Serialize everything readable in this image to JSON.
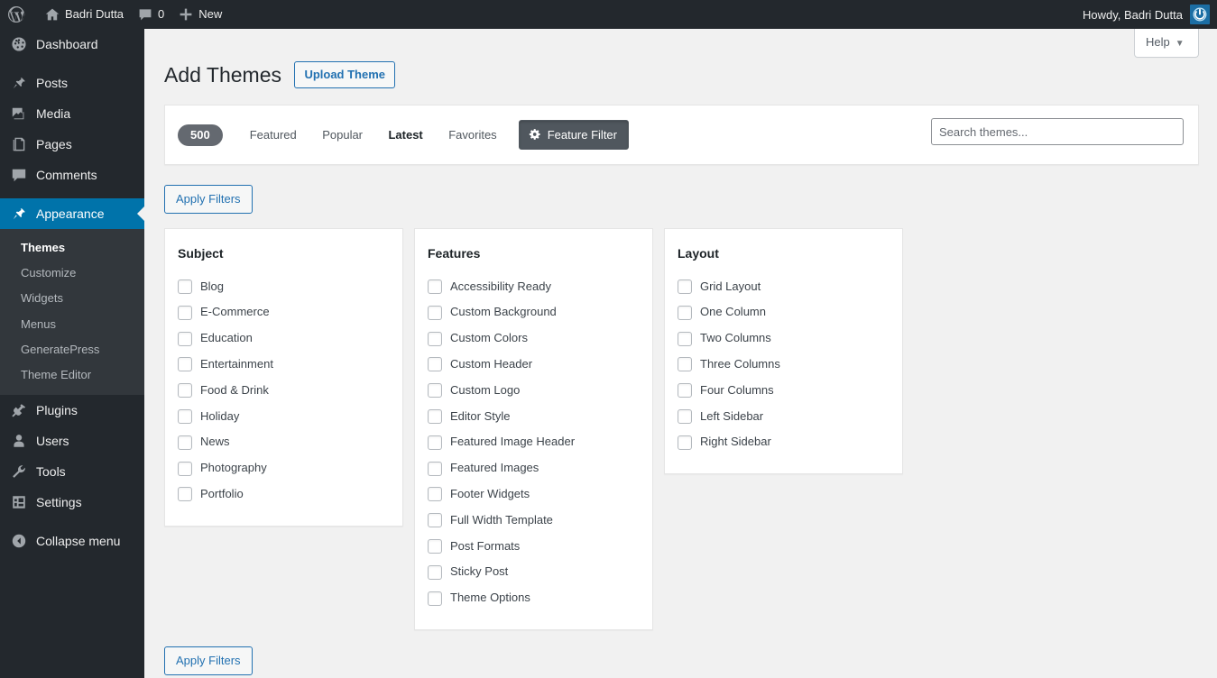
{
  "adminbar": {
    "wp_logo": "wordpress-logo-icon",
    "site_name": "Badri Dutta",
    "comments_count": "0",
    "new_label": "New",
    "howdy": "Howdy, Badri Dutta"
  },
  "sidebar": {
    "items": [
      {
        "label": "Dashboard",
        "icon": "dashboard-icon",
        "current": false
      },
      {
        "label": "Posts",
        "icon": "pin-icon",
        "current": false
      },
      {
        "label": "Media",
        "icon": "media-icon",
        "current": false
      },
      {
        "label": "Pages",
        "icon": "pages-icon",
        "current": false
      },
      {
        "label": "Comments",
        "icon": "comments-icon",
        "current": false
      },
      {
        "label": "Appearance",
        "icon": "appearance-icon",
        "current": true
      },
      {
        "label": "Plugins",
        "icon": "plugins-icon",
        "current": false
      },
      {
        "label": "Users",
        "icon": "users-icon",
        "current": false
      },
      {
        "label": "Tools",
        "icon": "tools-icon",
        "current": false
      },
      {
        "label": "Settings",
        "icon": "settings-icon",
        "current": false
      },
      {
        "label": "Collapse menu",
        "icon": "collapse-icon",
        "current": false
      }
    ],
    "appearance_submenu": [
      {
        "label": "Themes",
        "current": true
      },
      {
        "label": "Customize",
        "current": false
      },
      {
        "label": "Widgets",
        "current": false
      },
      {
        "label": "Menus",
        "current": false
      },
      {
        "label": "GeneratePress",
        "current": false
      },
      {
        "label": "Theme Editor",
        "current": false
      }
    ]
  },
  "screen_meta": {
    "help_label": "Help",
    "help_caret": "▼"
  },
  "page": {
    "title": "Add Themes",
    "upload_theme_label": "Upload Theme"
  },
  "theme_navigation": {
    "count": "500",
    "tabs": [
      {
        "label": "Featured",
        "current": false
      },
      {
        "label": "Popular",
        "current": false
      },
      {
        "label": "Latest",
        "current": true
      },
      {
        "label": "Favorites",
        "current": false
      }
    ],
    "feature_filter_label": "Feature Filter",
    "feature_filter_icon": "gear-icon",
    "search_placeholder": "Search themes...",
    "search_value": ""
  },
  "filter_drawer": {
    "apply_filters_top": "Apply Filters",
    "apply_filters_bottom": "Apply Filters",
    "groups": [
      {
        "title": "Subject",
        "options": [
          "Blog",
          "E-Commerce",
          "Education",
          "Entertainment",
          "Food & Drink",
          "Holiday",
          "News",
          "Photography",
          "Portfolio"
        ]
      },
      {
        "title": "Features",
        "options": [
          "Accessibility Ready",
          "Custom Background",
          "Custom Colors",
          "Custom Header",
          "Custom Logo",
          "Editor Style",
          "Featured Image Header",
          "Featured Images",
          "Footer Widgets",
          "Full Width Template",
          "Post Formats",
          "Sticky Post",
          "Theme Options"
        ]
      },
      {
        "title": "Layout",
        "options": [
          "Grid Layout",
          "One Column",
          "Two Columns",
          "Three Columns",
          "Four Columns",
          "Left Sidebar",
          "Right Sidebar"
        ]
      }
    ]
  },
  "colors": {
    "admin_dark": "#23282d",
    "admin_submenu": "#32373c",
    "accent_blue": "#0073aa",
    "link_blue": "#2271b1",
    "badge_gray": "#646970",
    "page_bg": "#f1f1f1"
  }
}
